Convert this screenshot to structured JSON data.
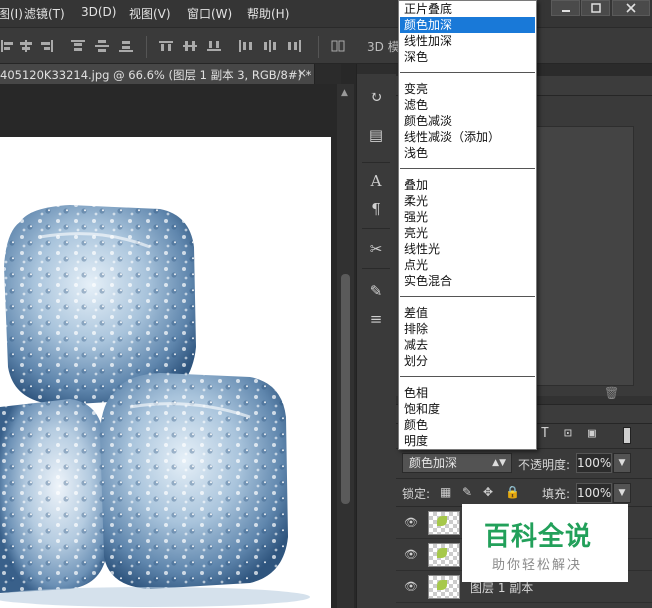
{
  "menubar": {
    "items": [
      "图(I)",
      "滤镜(T)",
      "3D(D)",
      "视图(V)",
      "窗口(W)",
      "帮助(H)"
    ]
  },
  "optbar": {
    "mode_3d_label": "3D 模"
  },
  "document": {
    "tab_title": "405120K33214.jpg @ 66.6% (图层 1 副本 3, RGB/8#) *",
    "close_symbol": "×"
  },
  "blend_modes": {
    "groups": [
      [
        "正片叠底",
        "颜色加深",
        "线性加深",
        "深色"
      ],
      [
        "变亮",
        "滤色",
        "颜色减淡",
        "线性减淡（添加）",
        "浅色"
      ],
      [
        "叠加",
        "柔光",
        "强光",
        "亮光",
        "线性光",
        "点光",
        "实色混合"
      ],
      [
        "差值",
        "排除",
        "减去",
        "划分"
      ],
      [
        "色相",
        "饱和度",
        "颜色",
        "明度"
      ]
    ],
    "selected": "颜色加深"
  },
  "layers_panel": {
    "blend_mode_value": "颜色加深",
    "opacity_label": "不透明度:",
    "opacity_value": "100%",
    "lock_label": "锁定:",
    "fill_label": "填充:",
    "fill_value": "100%",
    "layers": [
      {
        "name": ""
      },
      {
        "name": ""
      },
      {
        "name": "图层 1 副本"
      }
    ]
  },
  "watermark": {
    "title": "百科全说",
    "subtitle": "助你轻松解决"
  }
}
